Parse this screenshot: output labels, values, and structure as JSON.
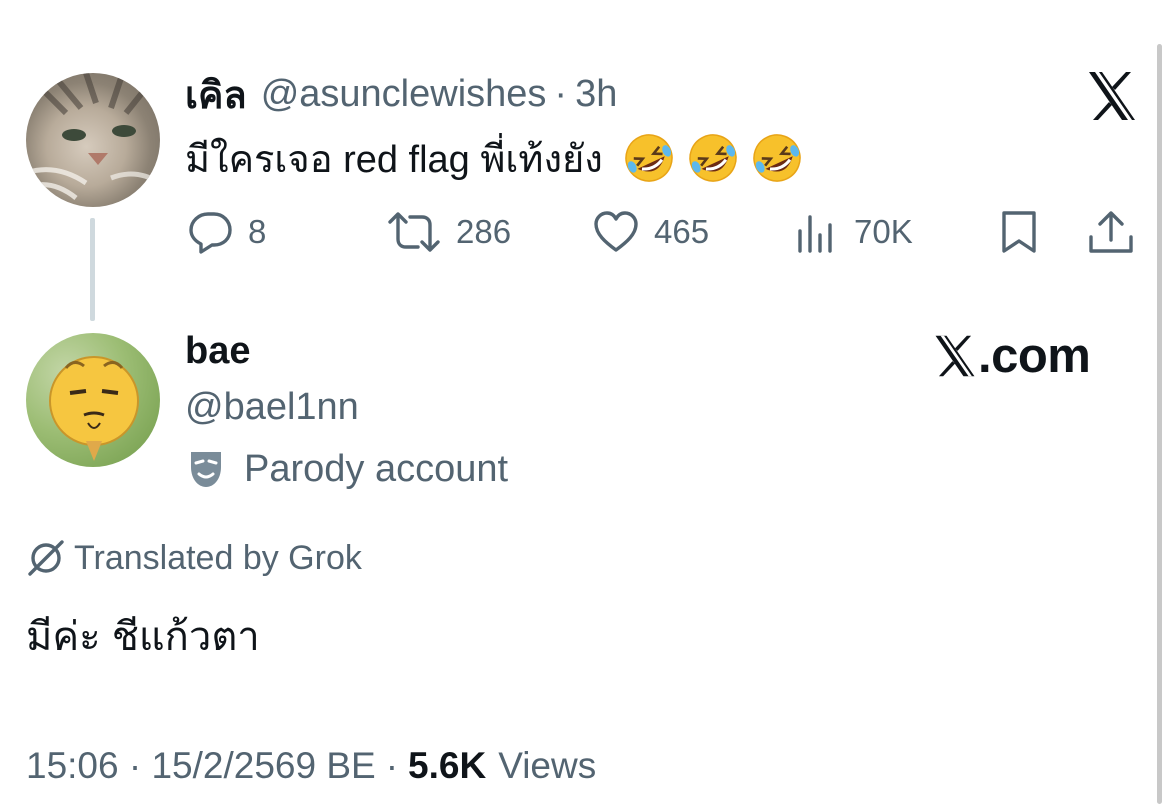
{
  "tweet": {
    "author_name": "เคิล",
    "author_handle": "@asunclewishes",
    "separator": "·",
    "time": "3h",
    "text": "มีใครเจอ red flag พี่เท้งยัง",
    "emojis": [
      "rolling-on-floor-laughing",
      "rolling-on-floor-laughing",
      "rolling-on-floor-laughing"
    ],
    "actions": {
      "replies": "8",
      "reposts": "286",
      "likes": "465",
      "views": "70K"
    }
  },
  "reply": {
    "author_name": "bae",
    "author_handle": "@bael1nn",
    "parody_label": "Parody account",
    "translated_label": "Translated by Grok",
    "text": "มีค่ะ ชีแก้วตา",
    "timestamp": "15:06 · 15/2/2569 BE",
    "separator": "·",
    "views_count": "5.6K",
    "views_label": "Views"
  },
  "branding": {
    "xcom_label": ".com"
  },
  "icons": {
    "top_right": "x-logo-icon",
    "reply": "reply-icon",
    "repost": "repost-icon",
    "like": "heart-icon",
    "views": "analytics-icon",
    "bookmark": "bookmark-icon",
    "share": "share-icon",
    "parody": "theater-mask-icon",
    "translate": "grok-icon"
  },
  "colors": {
    "text": "#0f1419",
    "muted": "#536471",
    "thread_line": "#cfd9de"
  }
}
